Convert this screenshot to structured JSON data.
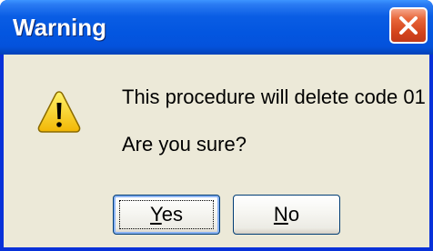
{
  "window": {
    "title": "Warning",
    "close_icon": "close-icon"
  },
  "message": {
    "icon": "warning-triangle-icon",
    "line1": "This procedure will delete code 01",
    "line2": "Are you sure?"
  },
  "buttons": {
    "yes": {
      "label": "Yes",
      "accelerator": "Y",
      "rest": "es"
    },
    "no": {
      "label": "No",
      "accelerator": "N",
      "rest": "o"
    }
  },
  "colors": {
    "titlebar": "#0356e0",
    "close_button": "#d4451c",
    "dialog_face": "#ece9d8",
    "warning_yellow": "#f8d21b"
  }
}
